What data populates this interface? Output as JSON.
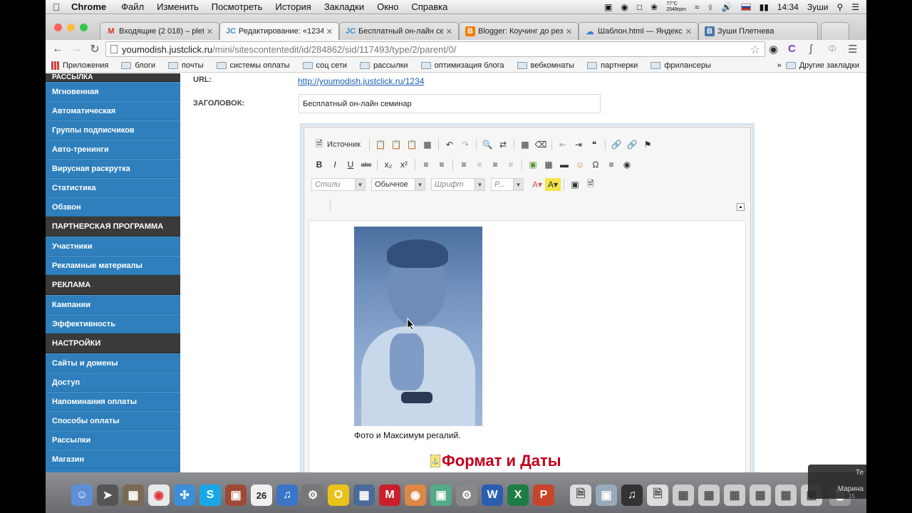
{
  "menubar": {
    "app": "Chrome",
    "items": [
      "Файл",
      "Изменить",
      "Посмотреть",
      "История",
      "Закладки",
      "Окно",
      "Справка"
    ],
    "temp": "77°C",
    "rpm": "2548rpm",
    "time": "14:34",
    "user": "Зуши"
  },
  "tabs": [
    {
      "label": "Входящие (2 018) – plet",
      "icon": "gmail-icon",
      "color": "#d93025",
      "glyph": "M"
    },
    {
      "label": "Редактирование: «1234»",
      "icon": "justclick-icon",
      "color": "#3a8fc9",
      "glyph": "JC"
    },
    {
      "label": "Бесплатный он-лайн сем",
      "icon": "justclick-icon",
      "color": "#3a8fc9",
      "glyph": "JC"
    },
    {
      "label": "Blogger: Коучинг до рез",
      "icon": "blogger-icon",
      "color": "#f57d00",
      "glyph": "B"
    },
    {
      "label": "Шаблон.html — Яндекс.",
      "icon": "yandex-disk-icon",
      "color": "#3a7bd5",
      "glyph": "Я"
    },
    {
      "label": "Зуши Плетнева",
      "icon": "vk-icon",
      "color": "#4a76a8",
      "glyph": "B"
    }
  ],
  "address": {
    "host": "youmodish.justclick.ru",
    "path": "/mini/sitescontentedit/id/284862/sid/117493/type/2/parent/0/"
  },
  "bookmarks": {
    "apps": "Приложения",
    "items": [
      "блоги",
      "почты",
      "системы оплаты",
      "соц сети",
      "рассылки",
      "оптимизация блога",
      "вебкомнаты",
      "партнерки",
      "фрилансеры"
    ],
    "other": "Другие закладки"
  },
  "sidebar": {
    "top_partial": "РАССЫЛКА",
    "groups": [
      {
        "head": null,
        "items": [
          "Мгновенная",
          "Автоматическая",
          "Группы подписчиков",
          "Авто-тренинги",
          "Вирусная раскрутка",
          "Статистика",
          "Обзвон"
        ]
      },
      {
        "head": "ПАРТНЕРСКАЯ ПРОГРАММА",
        "items": [
          "Участники",
          "Рекламные материалы"
        ]
      },
      {
        "head": "РЕКЛАМА",
        "items": [
          "Кампании",
          "Эффективность"
        ]
      },
      {
        "head": "НАСТРОЙКИ",
        "items": [
          "Сайты и домены",
          "Доступ",
          "Напоминания оплаты",
          "Способы оплаты",
          "Рассылки",
          "Магазин"
        ]
      }
    ]
  },
  "form": {
    "url_label": "URL:",
    "url_value": "http://youmodish.justclick.ru/1234",
    "title_label": "ЗАГОЛОВОК:",
    "title_value": "Бесплатный он-лайн семинар"
  },
  "editor": {
    "source_label": "Источник",
    "combo_styles": "Стили",
    "combo_format": "Обычное",
    "combo_font": "Шрифт",
    "combo_size": "Р...",
    "caption": "Фото и  Максимум регалий.",
    "heading": "Формат и Даты"
  },
  "notification": {
    "line1": "Те",
    "line2": "Марина",
    "line3": "15"
  }
}
